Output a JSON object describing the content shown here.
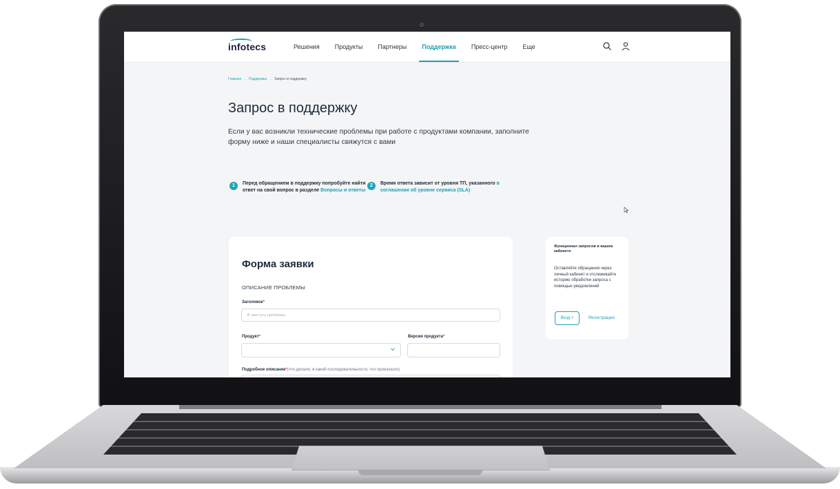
{
  "nav": {
    "logo": "infotecs",
    "items": [
      {
        "label": "Решения",
        "active": false
      },
      {
        "label": "Продукты",
        "active": false
      },
      {
        "label": "Партнеры",
        "active": false
      },
      {
        "label": "Поддержка",
        "active": true
      },
      {
        "label": "Пресс-центр",
        "active": false
      },
      {
        "label": "Еще",
        "active": false
      }
    ]
  },
  "breadcrumb": {
    "items": [
      "Главная",
      "Поддержка",
      "Запрос в поддержку"
    ],
    "separator": "→"
  },
  "page": {
    "title": "Запрос в поддержку",
    "intro": "Если у вас возникли технические проблемы при работе с продуктами компании, заполните форму ниже и наши специалисты свяжутся с вами"
  },
  "notes": [
    {
      "number": "1",
      "text": "Перед обращением в поддержку попробуйте найти ответ на свой вопрос в разделе ",
      "link": "Вопросы и ответы"
    },
    {
      "number": "2",
      "text": "Время ответа зависит от уровня ТП, указанного ",
      "link": "в соглашении об уровне сервиса (SLA)"
    }
  ],
  "form": {
    "title": "Форма заявки",
    "section": "ОПИСАНИЕ ПРОБЛЕМЫ",
    "heading_label": "Заголовок",
    "heading_placeholder": "В чем суть проблемы",
    "product_label": "Продукт",
    "version_label": "Версия продукта",
    "description_label": "Подробное описание",
    "description_hint": "(что делали, в какой последовательности, что произошло)",
    "required_mark": "*"
  },
  "sidebar": {
    "title": "Функционал запросов в вашем кабинете",
    "text": "Оставляйте обращения через личный кабинет и отслеживайте историю обработки запроса с помощью уведомлений",
    "login_button": "Вход >",
    "register_link": "Регистрация"
  },
  "colors": {
    "accent": "#1f9fb0",
    "title": "#1c2b3a",
    "page_bg": "#f4f5f6",
    "required": "#e53935"
  }
}
